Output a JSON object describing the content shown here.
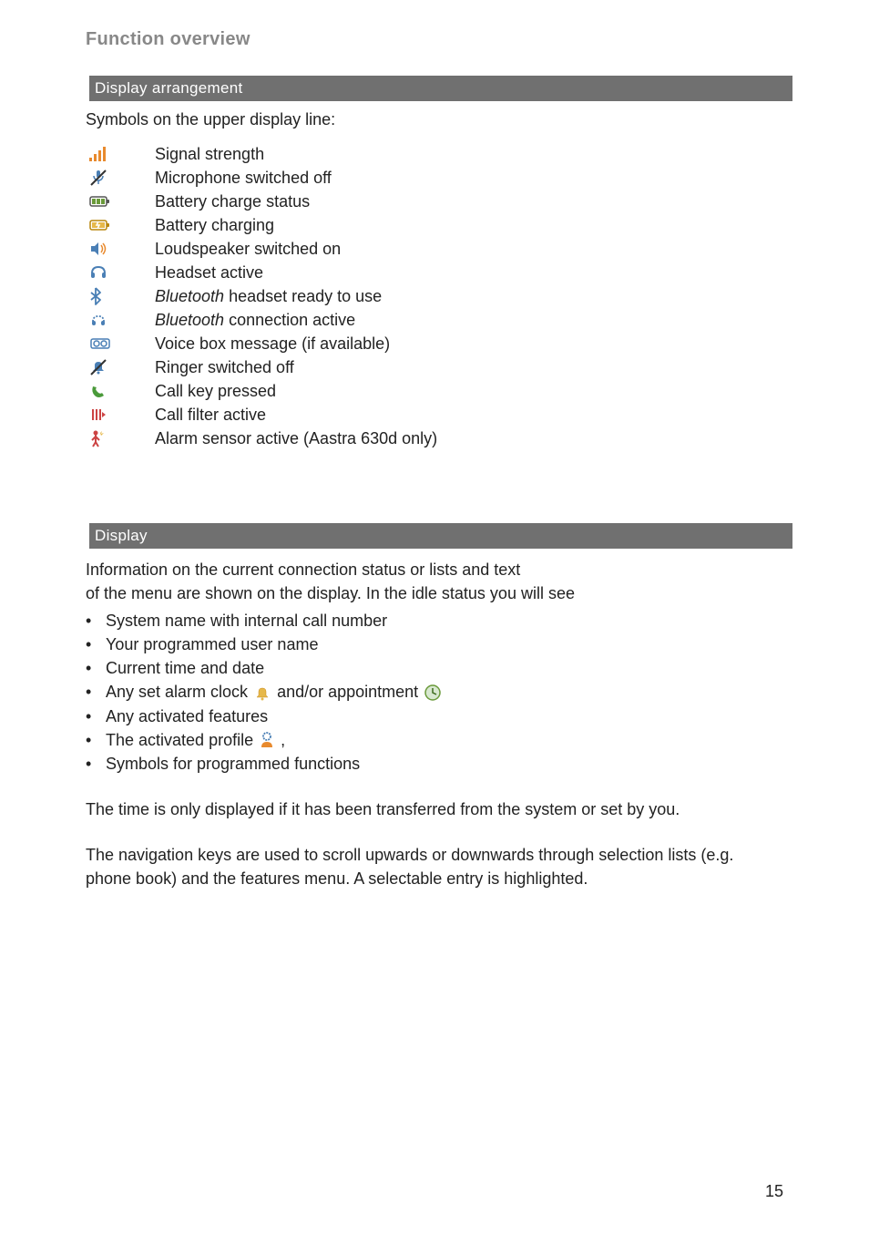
{
  "header": {
    "title": "Function overview"
  },
  "sections": {
    "arrangement": {
      "bar_label": "Display arrangement",
      "intro": "Symbols on the upper display line:",
      "symbols": [
        {
          "name": "signal-strength-icon",
          "label": "Signal strength",
          "italic_prefix": ""
        },
        {
          "name": "mic-off-icon",
          "label": "Microphone switched off",
          "italic_prefix": ""
        },
        {
          "name": "battery-status-icon",
          "label": "Battery charge status",
          "italic_prefix": ""
        },
        {
          "name": "battery-charging-icon",
          "label": "Battery charging",
          "italic_prefix": ""
        },
        {
          "name": "loudspeaker-on-icon",
          "label": "Loudspeaker switched on",
          "italic_prefix": ""
        },
        {
          "name": "headset-active-icon",
          "label": "Headset active",
          "italic_prefix": ""
        },
        {
          "name": "bluetooth-ready-icon",
          "label": " headset ready to use",
          "italic_prefix": "Bluetooth"
        },
        {
          "name": "bluetooth-active-icon",
          "label": " connection active",
          "italic_prefix": "Bluetooth"
        },
        {
          "name": "voice-box-icon",
          "label": "Voice box message (if available)",
          "italic_prefix": ""
        },
        {
          "name": "ringer-off-icon",
          "label": "Ringer switched off",
          "italic_prefix": ""
        },
        {
          "name": "call-key-icon",
          "label": "Call key pressed",
          "italic_prefix": ""
        },
        {
          "name": "call-filter-icon",
          "label": "Call filter active",
          "italic_prefix": ""
        },
        {
          "name": "alarm-sensor-icon",
          "label": "Alarm sensor active (Aastra 630d only)",
          "italic_prefix": ""
        }
      ]
    },
    "display": {
      "bar_label": "Display",
      "intro_line1": "Information on the current connection status or lists and text",
      "intro_line2": "of the menu are shown on the display. In the idle status you will see",
      "items": {
        "i0": "System name with internal call number",
        "i1": "Your programmed user name",
        "i2": "Current time and date",
        "i3_a": "Any set alarm clock",
        "i3_b": "and/or appointment",
        "i4": "Any activated features",
        "i5_a": "The activated profile",
        "i5_b": ",",
        "i6": "Symbols for programmed functions"
      },
      "para1": "The time is only displayed if it has been transferred from the system or set by you.",
      "para2": "The navigation keys are used to scroll upwards or downwards through selection lists (e.g. phone book) and the features menu. A selectable entry is highlighted."
    }
  },
  "page_number": "15"
}
